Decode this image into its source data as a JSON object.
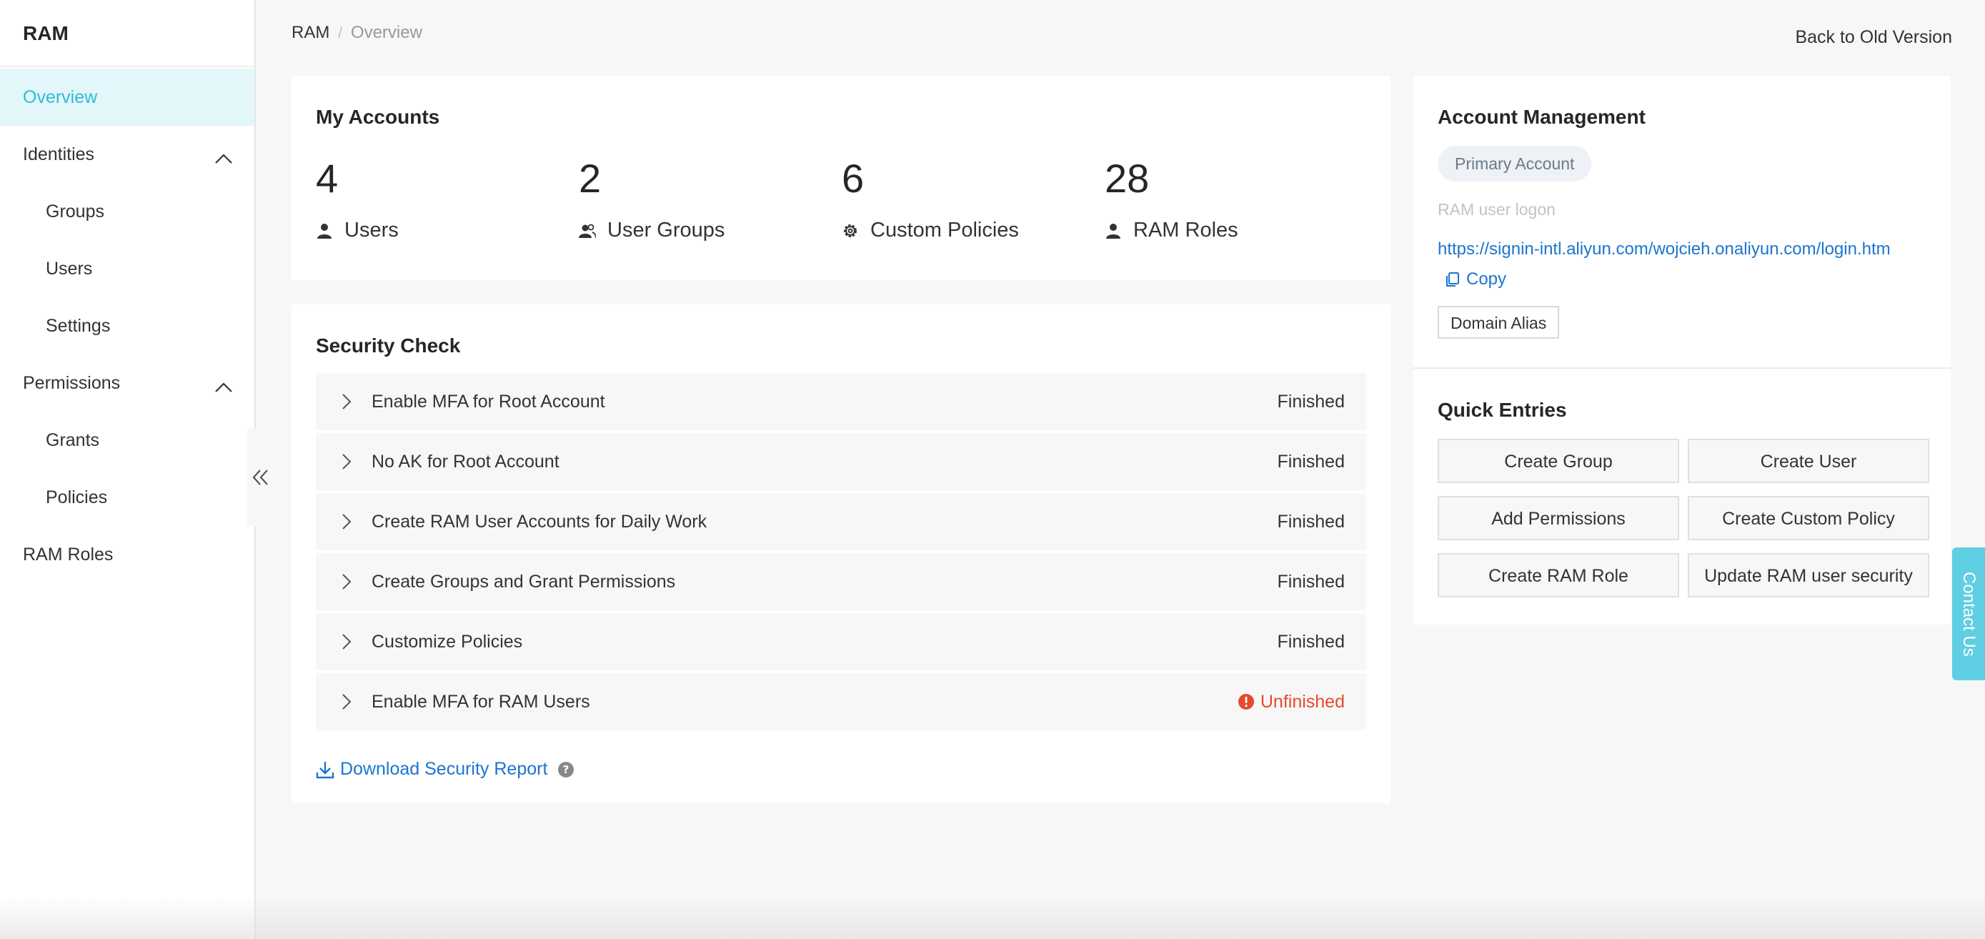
{
  "sidebar": {
    "title": "RAM",
    "items": [
      {
        "label": "Overview"
      },
      {
        "label": "Identities"
      },
      {
        "label": "Groups"
      },
      {
        "label": "Users"
      },
      {
        "label": "Settings"
      },
      {
        "label": "Permissions"
      },
      {
        "label": "Grants"
      },
      {
        "label": "Policies"
      },
      {
        "label": "RAM Roles"
      }
    ]
  },
  "breadcrumb": {
    "root": "RAM",
    "separator": "/",
    "current": "Overview"
  },
  "back_link": "Back to Old Version",
  "accounts": {
    "title": "My Accounts",
    "stats": [
      {
        "value": "4",
        "label": "Users",
        "icon": "user-icon"
      },
      {
        "value": "2",
        "label": "User Groups",
        "icon": "user-group-icon"
      },
      {
        "value": "6",
        "label": "Custom Policies",
        "icon": "gear-icon"
      },
      {
        "value": "28",
        "label": "RAM Roles",
        "icon": "user-icon"
      }
    ]
  },
  "security": {
    "title": "Security Check",
    "items": [
      {
        "name": "Enable MFA for Root Account",
        "status": "Finished"
      },
      {
        "name": "No AK for Root Account",
        "status": "Finished"
      },
      {
        "name": "Create RAM User Accounts for Daily Work",
        "status": "Finished"
      },
      {
        "name": "Create Groups and Grant Permissions",
        "status": "Finished"
      },
      {
        "name": "Customize Policies",
        "status": "Finished"
      },
      {
        "name": "Enable MFA for RAM Users",
        "status": "Unfinished"
      }
    ],
    "download_label": "Download Security Report"
  },
  "account_management": {
    "title": "Account Management",
    "badge": "Primary Account",
    "logon_label": "RAM user logon",
    "logon_url": "https://signin-intl.aliyun.com/wojcieh.onaliyun.com/login.htm",
    "copy_label": "Copy",
    "alias_button": "Domain Alias"
  },
  "quick_entries": {
    "title": "Quick Entries",
    "buttons": [
      {
        "label": "Create Group"
      },
      {
        "label": "Create User"
      },
      {
        "label": "Add Permissions"
      },
      {
        "label": "Create Custom Policy"
      },
      {
        "label": "Create RAM Role"
      },
      {
        "label": "Update RAM user security"
      }
    ]
  },
  "contact": "Contact Us",
  "colors": {
    "accent": "#2ebdd6",
    "link": "#1b75d0",
    "error": "#e64a2e",
    "active_bg": "#e3f6fa"
  }
}
